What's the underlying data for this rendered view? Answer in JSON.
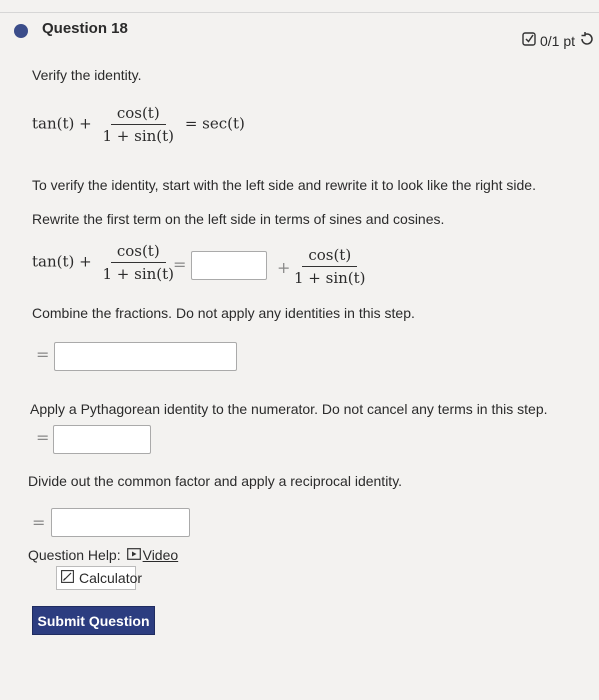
{
  "question": {
    "title": "Question 18",
    "points": "0/1 pt"
  },
  "prompt": "Verify the identity.",
  "identity": {
    "lhs_term1": "tan(t) +",
    "numerator": "cos(t)",
    "denominator": "1 + sin(t)",
    "rhs": "= sec(t)"
  },
  "instructions": {
    "start": "To verify the identity, start with the left side and rewrite it to look like the right side.",
    "step1": "Rewrite the first term on the left side in terms of sines and cosines.",
    "step2": "Combine the fractions. Do not apply any identities in this step.",
    "step3": "Apply a Pythagorean identity to the numerator. Do not cancel any terms in this step.",
    "step4": "Divide out the common factor and apply a reciprocal identity."
  },
  "eq_step1": {
    "lhs_term1": "tan(t) +",
    "numerator": "cos(t)",
    "denominator": "1 + sin(t)",
    "equals": "=",
    "plus": "+",
    "rhs_numerator": "cos(t)",
    "rhs_denominator": "1 + sin(t)"
  },
  "equals_symbol": "=",
  "help": {
    "label": "Question Help:",
    "video": "Video",
    "calculator": "Calculator"
  },
  "submit_label": "Submit Question"
}
